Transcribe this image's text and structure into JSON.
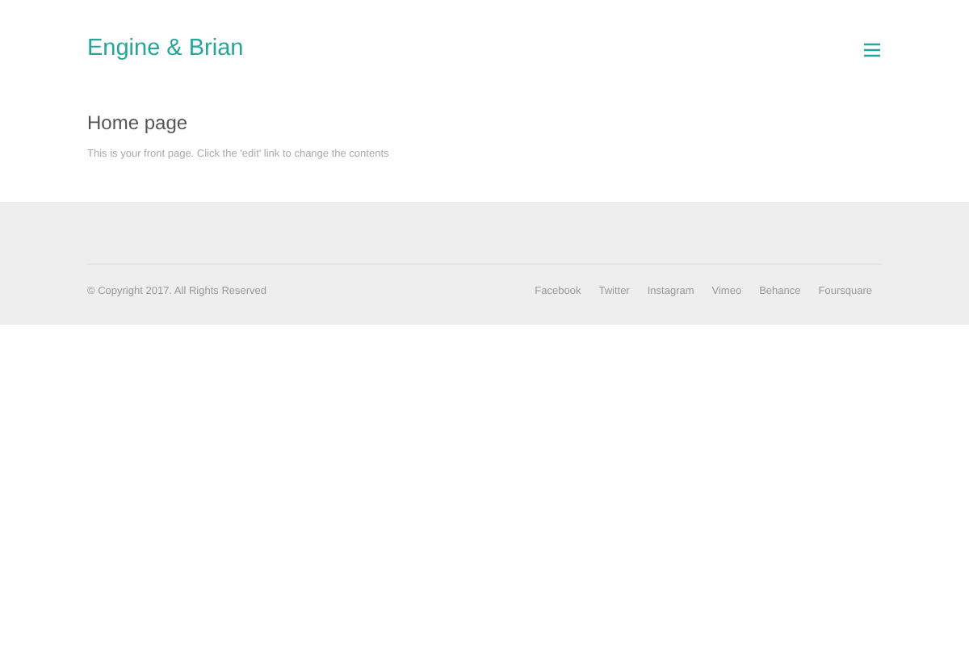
{
  "header": {
    "brand": "Engine & Brian"
  },
  "content": {
    "title": "Home page",
    "text": "This is your front page. Click the 'edit' link to change the contents"
  },
  "footer": {
    "copyright": "© Copyright 2017. All Rights Reserved",
    "links": [
      "Facebook",
      "Twitter",
      "Instagram",
      "Vimeo",
      "Behance",
      "Foursquare"
    ]
  }
}
